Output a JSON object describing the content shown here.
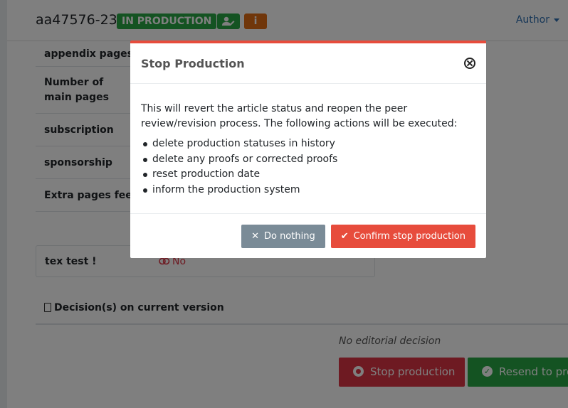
{
  "header": {
    "article_id": "aa47576-23",
    "status_badge": "IN PRODUCTION",
    "user_icon": "user-edit-icon",
    "info_icon": "info-icon",
    "info_glyph": "i",
    "author_menu": "Author"
  },
  "fields": [
    {
      "label": "appendix pages"
    },
    {
      "label": "Number of main pages"
    },
    {
      "label": "subscription"
    },
    {
      "label": "sponsorship"
    },
    {
      "label": "Extra pages fee"
    }
  ],
  "tex_test": {
    "label": "tex test !",
    "value": "No"
  },
  "decisions": {
    "header": "Decision(s) on current version",
    "empty_text": "No editorial decision",
    "stop_button": "Stop production",
    "resend_button": "Resend to pro"
  },
  "modal": {
    "title": "Stop Production",
    "description": "This will revert the article status and reopen the peer review/revision process. The following actions will be executed:",
    "actions": [
      "delete production statuses in history",
      "delete any proofs or corrected proofs",
      "reset production date",
      "inform the production system"
    ],
    "cancel_label": "Do nothing",
    "confirm_label": "Confirm stop production"
  },
  "colors": {
    "success": "#28a745",
    "danger": "#dc3545",
    "confirm": "#e74c3c",
    "secondary": "#7a8b97",
    "link": "#2f6fb0"
  }
}
